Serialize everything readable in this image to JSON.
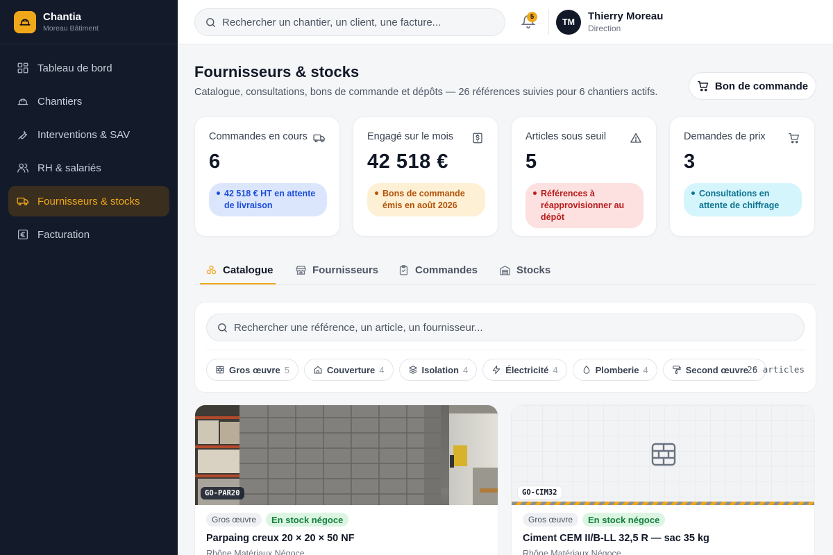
{
  "brand": {
    "name": "Chantia",
    "subtitle": "Moreau Bâtiment"
  },
  "sidebar": {
    "items": [
      {
        "label": "Tableau de bord",
        "icon": "dashboard-icon",
        "active": false
      },
      {
        "label": "Chantiers",
        "icon": "hard-hat-icon",
        "active": false
      },
      {
        "label": "Interventions & SAV",
        "icon": "wrench-icon",
        "active": false
      },
      {
        "label": "RH & salariés",
        "icon": "users-icon",
        "active": false
      },
      {
        "label": "Fournisseurs & stocks",
        "icon": "truck-icon",
        "active": true
      },
      {
        "label": "Facturation",
        "icon": "euro-icon",
        "active": false
      }
    ]
  },
  "topbar": {
    "search_placeholder": "Rechercher un chantier, un client, une facture...",
    "notifications": "5",
    "user": {
      "initials": "TM",
      "name": "Thierry Moreau",
      "role": "Direction"
    }
  },
  "page": {
    "title": "Fournisseurs & stocks",
    "subtitle": "Catalogue, consultations, bons de commande et dépôts — 26 références suivies pour 6 chantiers actifs.",
    "order_button": "Bon de commande"
  },
  "kpis": [
    {
      "label": "Commandes en cours",
      "value": "6",
      "note": "42 518 € HT en attente de livraison",
      "icon": "truck-icon",
      "tone": "blue"
    },
    {
      "label": "Engagé sur le mois",
      "value": "42 518  €",
      "note": "Bons de commande émis en août 2026",
      "icon": "receipt-icon",
      "tone": "amber"
    },
    {
      "label": "Articles sous seuil",
      "value": "5",
      "note": "Références à réapprovisionner au dépôt",
      "icon": "warning-icon",
      "tone": "red"
    },
    {
      "label": "Demandes de prix",
      "value": "3",
      "note": "Consultations en attente de chiffrage",
      "icon": "cart-icon",
      "tone": "cyan"
    }
  ],
  "tabs": [
    {
      "label": "Catalogue",
      "icon": "boxes-icon",
      "active": true
    },
    {
      "label": "Fournisseurs",
      "icon": "store-icon",
      "active": false
    },
    {
      "label": "Commandes",
      "icon": "clipboard-icon",
      "active": false
    },
    {
      "label": "Stocks",
      "icon": "warehouse-icon",
      "active": false
    }
  ],
  "catalog": {
    "search_placeholder": "Rechercher une référence, un article, un fournisseur...",
    "filters": [
      {
        "label": "Gros œuvre",
        "count": "5",
        "icon": "brick-icon"
      },
      {
        "label": "Couverture",
        "count": "4",
        "icon": "house-icon"
      },
      {
        "label": "Isolation",
        "count": "4",
        "icon": "layers-icon"
      },
      {
        "label": "Électricité",
        "count": "4",
        "icon": "bolt-icon"
      },
      {
        "label": "Plomberie",
        "count": "4",
        "icon": "drop-icon"
      },
      {
        "label": "Second œuvre",
        "count": "5",
        "icon": "paint-roller-icon"
      }
    ],
    "count_text": "26 articles",
    "products": [
      {
        "sku": "GO-PAR20",
        "category": "Gros œuvre",
        "stock": "En stock négoce",
        "name": "Parpaing creux 20 × 20 × 50 NF",
        "supplier": "Rhône Matériaux Négoce"
      },
      {
        "sku": "GO-CIM32",
        "category": "Gros œuvre",
        "stock": "En stock négoce",
        "name": "Ciment CEM II/B-LL 32,5 R — sac 35 kg",
        "supplier": "Rhône Matériaux Négoce"
      }
    ]
  },
  "colors": {
    "accent": "#f0a81b",
    "sidebar": "#131a2a",
    "stock_green": "#15803d"
  }
}
